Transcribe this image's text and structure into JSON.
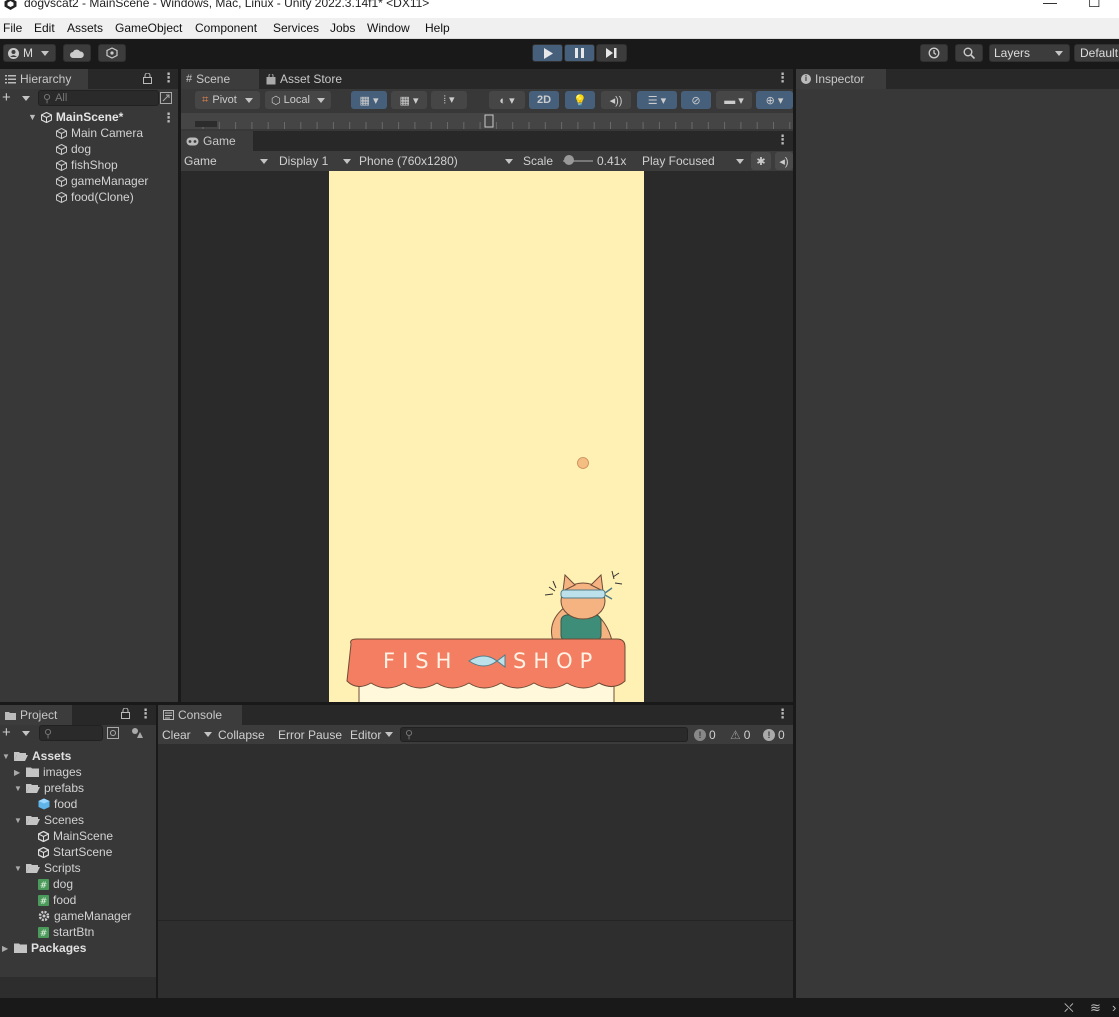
{
  "window": {
    "title": "dogvscat2 - MainScene - Windows, Mac, Linux - Unity 2022.3.14f1* <DX11>",
    "minimize_glyph": "—",
    "maximize_glyph": "☐"
  },
  "menu": [
    "File",
    "Edit",
    "Assets",
    "GameObject",
    "Component",
    "Services",
    "Jobs",
    "Window",
    "Help"
  ],
  "toolbar": {
    "account_label": "M",
    "layers_label": "Layers",
    "layout_label": "Default",
    "play_icon": "play-icon",
    "pause_icon": "pause-icon",
    "step_icon": "step-icon"
  },
  "hierarchy": {
    "tab": "Hierarchy",
    "search_placeholder": "All",
    "scene": "MainScene*",
    "items": [
      "Main Camera",
      "dog",
      "fishShop",
      "gameManager",
      "food(Clone)"
    ]
  },
  "scene_view": {
    "tabs": [
      "Scene",
      "Asset Store"
    ],
    "pivot": "Pivot",
    "local": "Local",
    "mode_2d": "2D"
  },
  "game_view": {
    "tab": "Game",
    "game_dropdown": "Game",
    "display": "Display 1",
    "resolution": "Phone (760x1280)",
    "scale_label": "Scale",
    "scale_value": "0.41x",
    "scale_level": 0.05,
    "play_mode": "Play Focused"
  },
  "game_canvas": {
    "background": "#fff0b4",
    "sign_text_left": "FISH",
    "sign_text_right": "SHOP",
    "awning_color": "#f47e62",
    "food_color": "#f4bd82"
  },
  "inspector": {
    "tab": "Inspector"
  },
  "project": {
    "tab": "Project",
    "tree": [
      {
        "label": "Assets",
        "kind": "folder-open",
        "depth": 0,
        "bold": true
      },
      {
        "label": "images",
        "kind": "folder",
        "depth": 1
      },
      {
        "label": "prefabs",
        "kind": "folder-open",
        "depth": 1
      },
      {
        "label": "food",
        "kind": "prefab",
        "depth": 2
      },
      {
        "label": "Scenes",
        "kind": "folder-open",
        "depth": 1
      },
      {
        "label": "MainScene",
        "kind": "scene",
        "depth": 2
      },
      {
        "label": "StartScene",
        "kind": "scene",
        "depth": 2
      },
      {
        "label": "Scripts",
        "kind": "folder-open",
        "depth": 1
      },
      {
        "label": "dog",
        "kind": "script",
        "depth": 2
      },
      {
        "label": "food",
        "kind": "script",
        "depth": 2
      },
      {
        "label": "gameManager",
        "kind": "gear",
        "depth": 2
      },
      {
        "label": "startBtn",
        "kind": "script",
        "depth": 2
      },
      {
        "label": "Packages",
        "kind": "folder",
        "depth": 0,
        "bold": true
      }
    ]
  },
  "console": {
    "tab": "Console",
    "clear": "Clear",
    "collapse": "Collapse",
    "error_pause": "Error Pause",
    "editor": "Editor",
    "info_count": "0",
    "warning_count": "0",
    "error_count": "0"
  }
}
